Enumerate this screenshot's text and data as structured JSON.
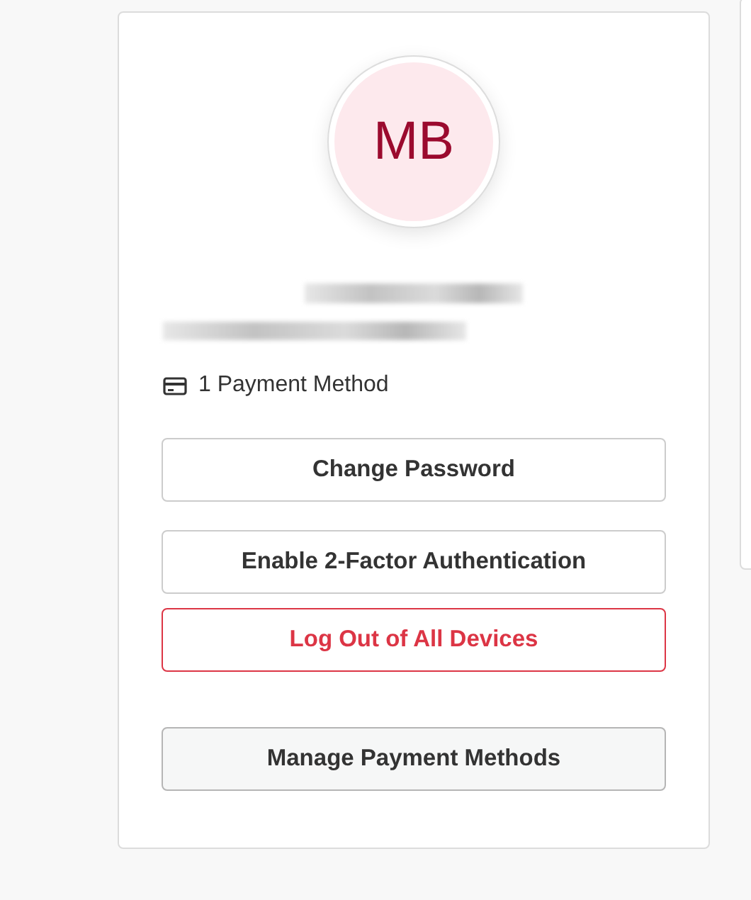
{
  "profile": {
    "initials": "MB",
    "payment_summary": "1 Payment Method"
  },
  "actions": [
    {
      "label": "Change Password",
      "kind": "default"
    },
    {
      "label": "Enable 2-Factor Authentication",
      "kind": "default"
    },
    {
      "label": "Log Out of All Devices",
      "kind": "danger"
    },
    {
      "label": "Manage Payment Methods",
      "kind": "secondary"
    }
  ]
}
